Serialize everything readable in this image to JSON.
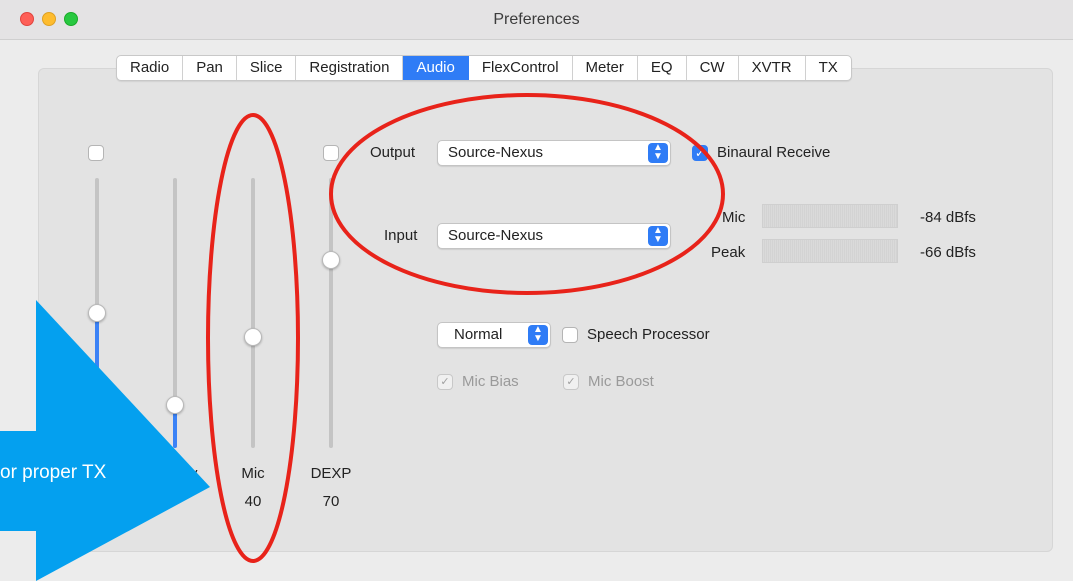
{
  "window": {
    "title": "Preferences"
  },
  "tabs": [
    "Radio",
    "Pan",
    "Slice",
    "Registration",
    "Audio",
    "FlexControl",
    "Meter",
    "EQ",
    "CW",
    "XVTR",
    "TX"
  ],
  "active_tab": "Audio",
  "sliders": {
    "slider1": {
      "label": "",
      "value": ""
    },
    "slider2": {
      "label": "y",
      "value": ""
    },
    "mic": {
      "label": "Mic",
      "value": "40"
    },
    "dexp": {
      "label": "DEXP",
      "value": "70"
    }
  },
  "output": {
    "label": "Output",
    "value": "Source-Nexus"
  },
  "input": {
    "label": "Input",
    "value": "Source-Nexus"
  },
  "binaural": {
    "label": "Binaural Receive",
    "checked": true
  },
  "meters": {
    "mic": {
      "label": "Mic",
      "value": "-84 dBfs"
    },
    "peak": {
      "label": "Peak",
      "value": "-66 dBfs"
    }
  },
  "mode_select": {
    "value": "Normal"
  },
  "speech_processor": {
    "label": "Speech Processor",
    "checked": false
  },
  "mic_bias": {
    "label": "Mic Bias",
    "checked": true,
    "enabled": false
  },
  "mic_boost": {
    "label": "Mic Boost",
    "checked": true,
    "enabled": false
  },
  "callout": {
    "text": "or proper TX"
  },
  "colors": {
    "accent": "#2f7cf6",
    "annotation": "#e8231a",
    "callout": "#04a0ef"
  }
}
